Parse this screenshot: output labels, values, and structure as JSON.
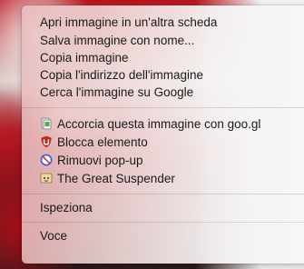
{
  "context_menu": {
    "group_image": [
      {
        "label": "Apri immagine in un'altra scheda"
      },
      {
        "label": "Salva immagine con nome..."
      },
      {
        "label": "Copia immagine"
      },
      {
        "label": "Copia l'indirizzo dell'immagine"
      },
      {
        "label": "Cerca l'immagine su Google"
      }
    ],
    "group_extensions": [
      {
        "label": "Accorcia questa immagine con goo.gl",
        "icon": "goo-gl-shortener-icon"
      },
      {
        "label": "Blocca elemento",
        "icon": "ublock-shield-icon"
      },
      {
        "label": "Rimuovi pop-up",
        "icon": "no-popup-icon"
      },
      {
        "label": "The Great Suspender",
        "icon": "great-suspender-icon"
      }
    ],
    "inspect_label": "Ispeziona",
    "voice_label": "Voce"
  },
  "colors": {
    "ublock_red": "#c1271d",
    "no_popup_blue": "#3a5bd9",
    "goo_gl_green": "#4caf50"
  }
}
